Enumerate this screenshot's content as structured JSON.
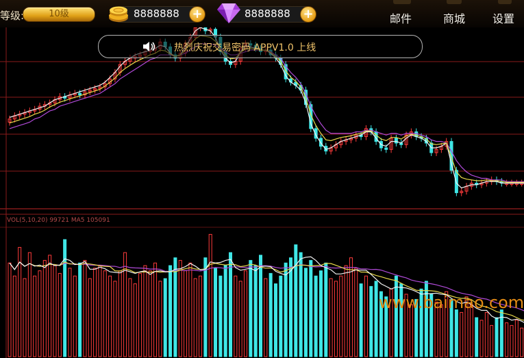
{
  "header": {
    "level_label": "等级:",
    "level_value": "10级",
    "coins": {
      "icon": "coin-stack-icon",
      "value": "8888888"
    },
    "gems": {
      "icon": "diamond-icon",
      "value": "8888888"
    },
    "add_symbol": "+",
    "nav": [
      {
        "key": "mail",
        "label": "邮件"
      },
      {
        "key": "shop",
        "label": "商城"
      },
      {
        "key": "settings",
        "label": "设置"
      }
    ]
  },
  "notice": {
    "icon": "speaker-icon",
    "text": "热烈庆祝交易密码 APPV1.0 上线"
  },
  "volume_panel": {
    "label": "VOL(5,10,20) 99721 MA5 105091"
  },
  "watermark": "www.baimao.com",
  "colors": {
    "up": "#ff3b3b",
    "down": "#3fe6e6",
    "ma_short": "#f2f2f2",
    "ma_mid": "#e8d84a",
    "ma_long": "#b04ad8",
    "grid": "#8a1a1a",
    "accent_gold": "#f0b020"
  },
  "chart_data": [
    {
      "type": "candlestick",
      "indicator": "price",
      "candle_count": 104,
      "close": [
        46,
        44,
        43,
        42,
        41,
        40,
        38,
        37,
        36,
        34,
        32,
        33,
        31,
        30,
        31,
        29,
        28,
        27,
        26,
        24,
        21,
        17,
        12,
        10,
        8,
        7,
        6,
        4,
        3,
        2,
        -2,
        1,
        6,
        8,
        5,
        -1,
        -5,
        -11,
        -12,
        -9,
        -10,
        -5,
        4,
        10,
        12,
        10,
        2,
        -1,
        0,
        2,
        4,
        3,
        6,
        8,
        12,
        21,
        23,
        25,
        28,
        37,
        52,
        58,
        63,
        66,
        64,
        62,
        60,
        59,
        58,
        56,
        57,
        52,
        54,
        60,
        64,
        65,
        58,
        61,
        62,
        56,
        54,
        57,
        58,
        61,
        67,
        65,
        63,
        60,
        78,
        92,
        91,
        88,
        86,
        87,
        86,
        85,
        84,
        85,
        86,
        86,
        86,
        86,
        86,
        86
      ],
      "ma_short": [
        45,
        44,
        43,
        42,
        41,
        40,
        39,
        38,
        36,
        34,
        33,
        32,
        31,
        30,
        29,
        28,
        27,
        26,
        25,
        23,
        20,
        17,
        13,
        10,
        8,
        6,
        5,
        4,
        3,
        2,
        0,
        1,
        5,
        7,
        6,
        1,
        -4,
        -9,
        -11,
        -10,
        -9,
        -5,
        3,
        8,
        11,
        10,
        4,
        0,
        1,
        2,
        3,
        3,
        5,
        8,
        12,
        19,
        23,
        25,
        28,
        36,
        49,
        56,
        61,
        65,
        64,
        62,
        60,
        59,
        58,
        57,
        56,
        54,
        54,
        58,
        62,
        63,
        60,
        60,
        61,
        58,
        56,
        57,
        58,
        60,
        64,
        64,
        63,
        61,
        74,
        86,
        89,
        88,
        87,
        87,
        86,
        85,
        85,
        85,
        86,
        86,
        86,
        86,
        86,
        86
      ],
      "ma_long": [
        52,
        51,
        50,
        49,
        48,
        46,
        45,
        43,
        41,
        40,
        38,
        37,
        36,
        35,
        34,
        33,
        32,
        31,
        30,
        28,
        26,
        24,
        21,
        19,
        17,
        15,
        13,
        11,
        9,
        8,
        6,
        6,
        6,
        7,
        6,
        5,
        3,
        1,
        -1,
        -1,
        -1,
        0,
        2,
        4,
        6,
        6,
        5,
        4,
        3,
        3,
        3,
        3,
        4,
        6,
        8,
        13,
        17,
        20,
        24,
        30,
        38,
        44,
        49,
        53,
        55,
        55,
        55,
        55,
        55,
        54,
        54,
        53,
        53,
        54,
        55,
        56,
        55,
        55,
        56,
        55,
        55,
        55,
        56,
        57,
        59,
        60,
        60,
        61,
        66,
        72,
        76,
        79,
        81,
        82,
        83,
        83,
        84,
        84,
        84,
        85,
        85,
        85,
        85,
        85
      ]
    },
    {
      "type": "bar",
      "indicator": "volume",
      "label": "VOL(5,10,20) 99721 MA5 105091",
      "values": [
        72,
        62,
        84,
        60,
        80,
        62,
        66,
        74,
        78,
        70,
        64,
        90,
        68,
        62,
        72,
        74,
        60,
        68,
        70,
        66,
        62,
        58,
        66,
        80,
        60,
        56,
        64,
        70,
        66,
        72,
        58,
        60,
        70,
        76,
        74,
        66,
        72,
        60,
        62,
        76,
        94,
        68,
        62,
        70,
        80,
        62,
        58,
        66,
        74,
        70,
        78,
        60,
        64,
        56,
        62,
        72,
        76,
        86,
        80,
        68,
        74,
        62,
        66,
        72,
        60,
        58,
        62,
        70,
        76,
        68,
        56,
        62,
        54,
        58,
        50,
        46,
        52,
        62,
        56,
        48,
        40,
        44,
        52,
        58,
        48,
        42,
        40,
        50,
        44,
        36,
        34,
        46,
        40,
        30,
        28,
        34,
        24,
        30,
        36,
        26,
        24,
        28,
        22,
        26
      ]
    }
  ]
}
